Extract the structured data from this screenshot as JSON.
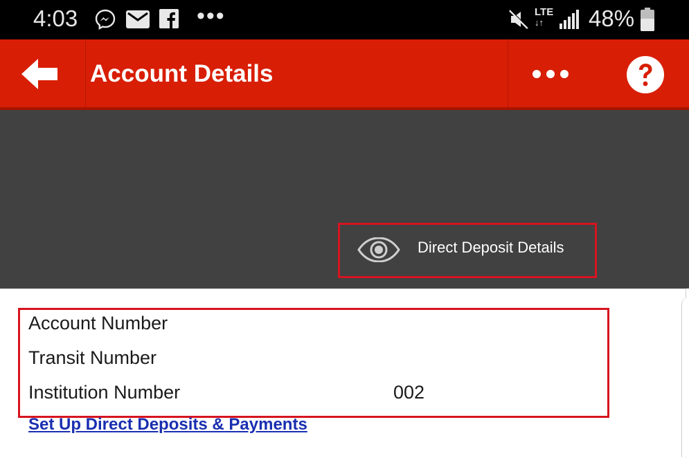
{
  "status_bar": {
    "time": "4:03",
    "icons": [
      "messenger-icon",
      "mail-icon",
      "facebook-icon"
    ],
    "more_dots": "•••",
    "network": "LTE",
    "battery_percent": "48%"
  },
  "header": {
    "title": "Account Details",
    "back_icon": "arrow-left-icon",
    "more_icon": "more-dots-icon",
    "help_icon": "help-question-icon",
    "color": "#d81e05"
  },
  "direct_deposit": {
    "label": "Direct Deposit Details",
    "icon": "eye-icon"
  },
  "details": {
    "rows": [
      {
        "label": "Account Number",
        "value": ""
      },
      {
        "label": "Transit Number",
        "value": ""
      },
      {
        "label": "Institution Number",
        "value": "002"
      }
    ],
    "setup_link": "Set Up Direct Deposits & Payments"
  },
  "colors": {
    "dark_band": "#414141",
    "highlight": "#d6141f",
    "link": "#1a2fb0"
  }
}
